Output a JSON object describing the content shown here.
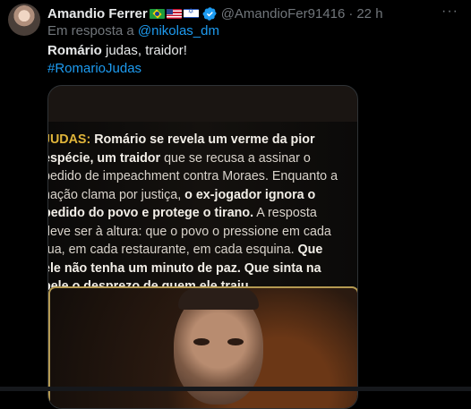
{
  "tweet": {
    "display_name": "Amandio Ferrer",
    "handle": "@AmandioFer91416",
    "separator": "·",
    "time": "22 h",
    "more_label": "···",
    "flags": [
      "brazil-flag-icon",
      "usa-flag-icon",
      "israel-flag-icon"
    ],
    "reply_prefix": "Em resposta a",
    "reply_to": "@nikolas_dm",
    "text_bold": "Romário",
    "text_rest": " judas, traidor!",
    "hashtag": "#RomarioJudas"
  },
  "media": {
    "label": "JUDAS:",
    "seg1": "Romário se revela um verme da pior espécie, um traidor",
    "seg2": " que se recusa a assinar o pedido de impeachment contra Moraes. Enquanto a nação clama por justiça, ",
    "seg3": "o ex-jogador ignora o pedido do povo e protege o tirano.",
    "seg4": " A resposta deve ser à altura: que o povo o pressione em cada rua, em cada restaurante, em cada esquina. ",
    "seg5": "Que ele não tenha um minuto de paz. Que sinta na pele o desprezo de quem ele traiu."
  },
  "colors": {
    "background": "#000000",
    "muted": "#71767b",
    "link": "#1d9bf0",
    "verified": "#1d9bf0",
    "highlight": "#e0b53a"
  }
}
